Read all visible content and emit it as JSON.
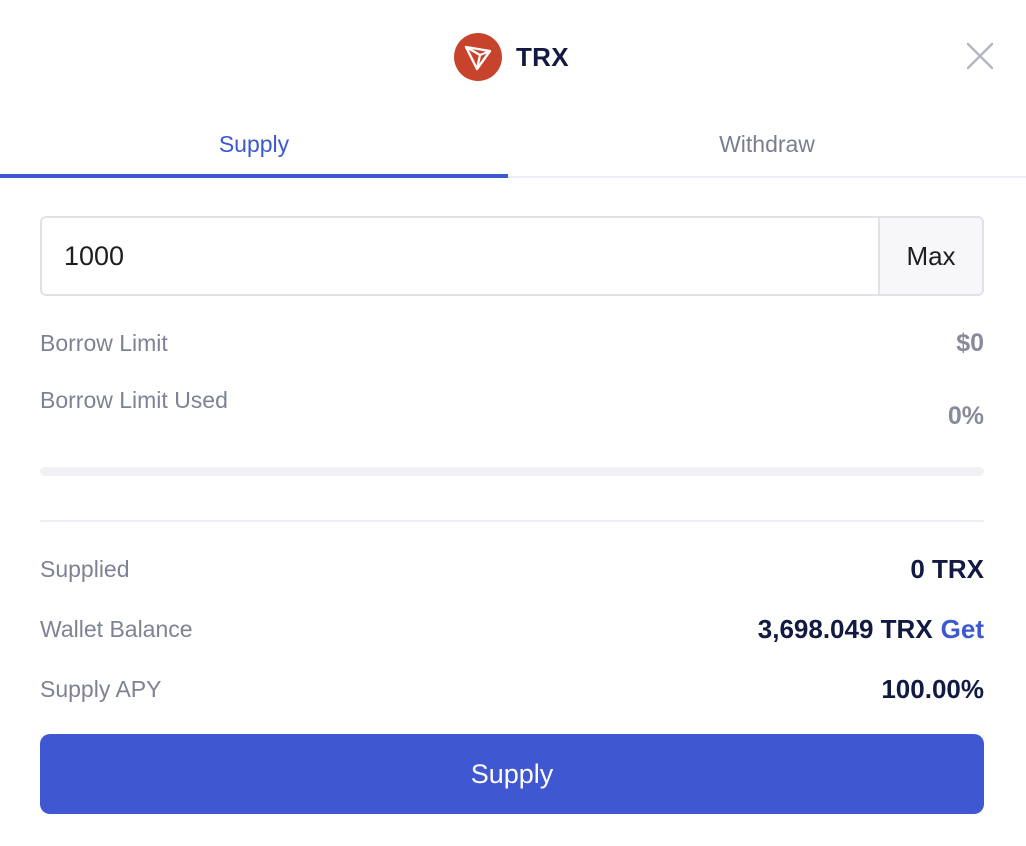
{
  "header": {
    "token_symbol": "TRX",
    "logo_icon": "tron-logo-icon",
    "logo_color": "#c8432b",
    "close_icon": "close-icon"
  },
  "tabs": [
    {
      "label": "Supply",
      "active": true
    },
    {
      "label": "Withdraw",
      "active": false
    }
  ],
  "amount_input": {
    "value": "1000",
    "max_label": "Max"
  },
  "borrow": {
    "limit_label": "Borrow Limit",
    "limit_value": "$0",
    "used_label": "Borrow Limit Used",
    "used_value": "0%",
    "used_fraction": 0
  },
  "stats": {
    "supplied_label": "Supplied",
    "supplied_value": "0 TRX",
    "wallet_label": "Wallet Balance",
    "wallet_value": "3,698.049 TRX",
    "get_label": "Get",
    "apy_label": "Supply APY",
    "apy_value": "100.00%"
  },
  "submit": {
    "label": "Supply"
  },
  "colors": {
    "accent": "#3d59d1",
    "text_dark": "#121a43",
    "text_muted": "#7e8296"
  }
}
